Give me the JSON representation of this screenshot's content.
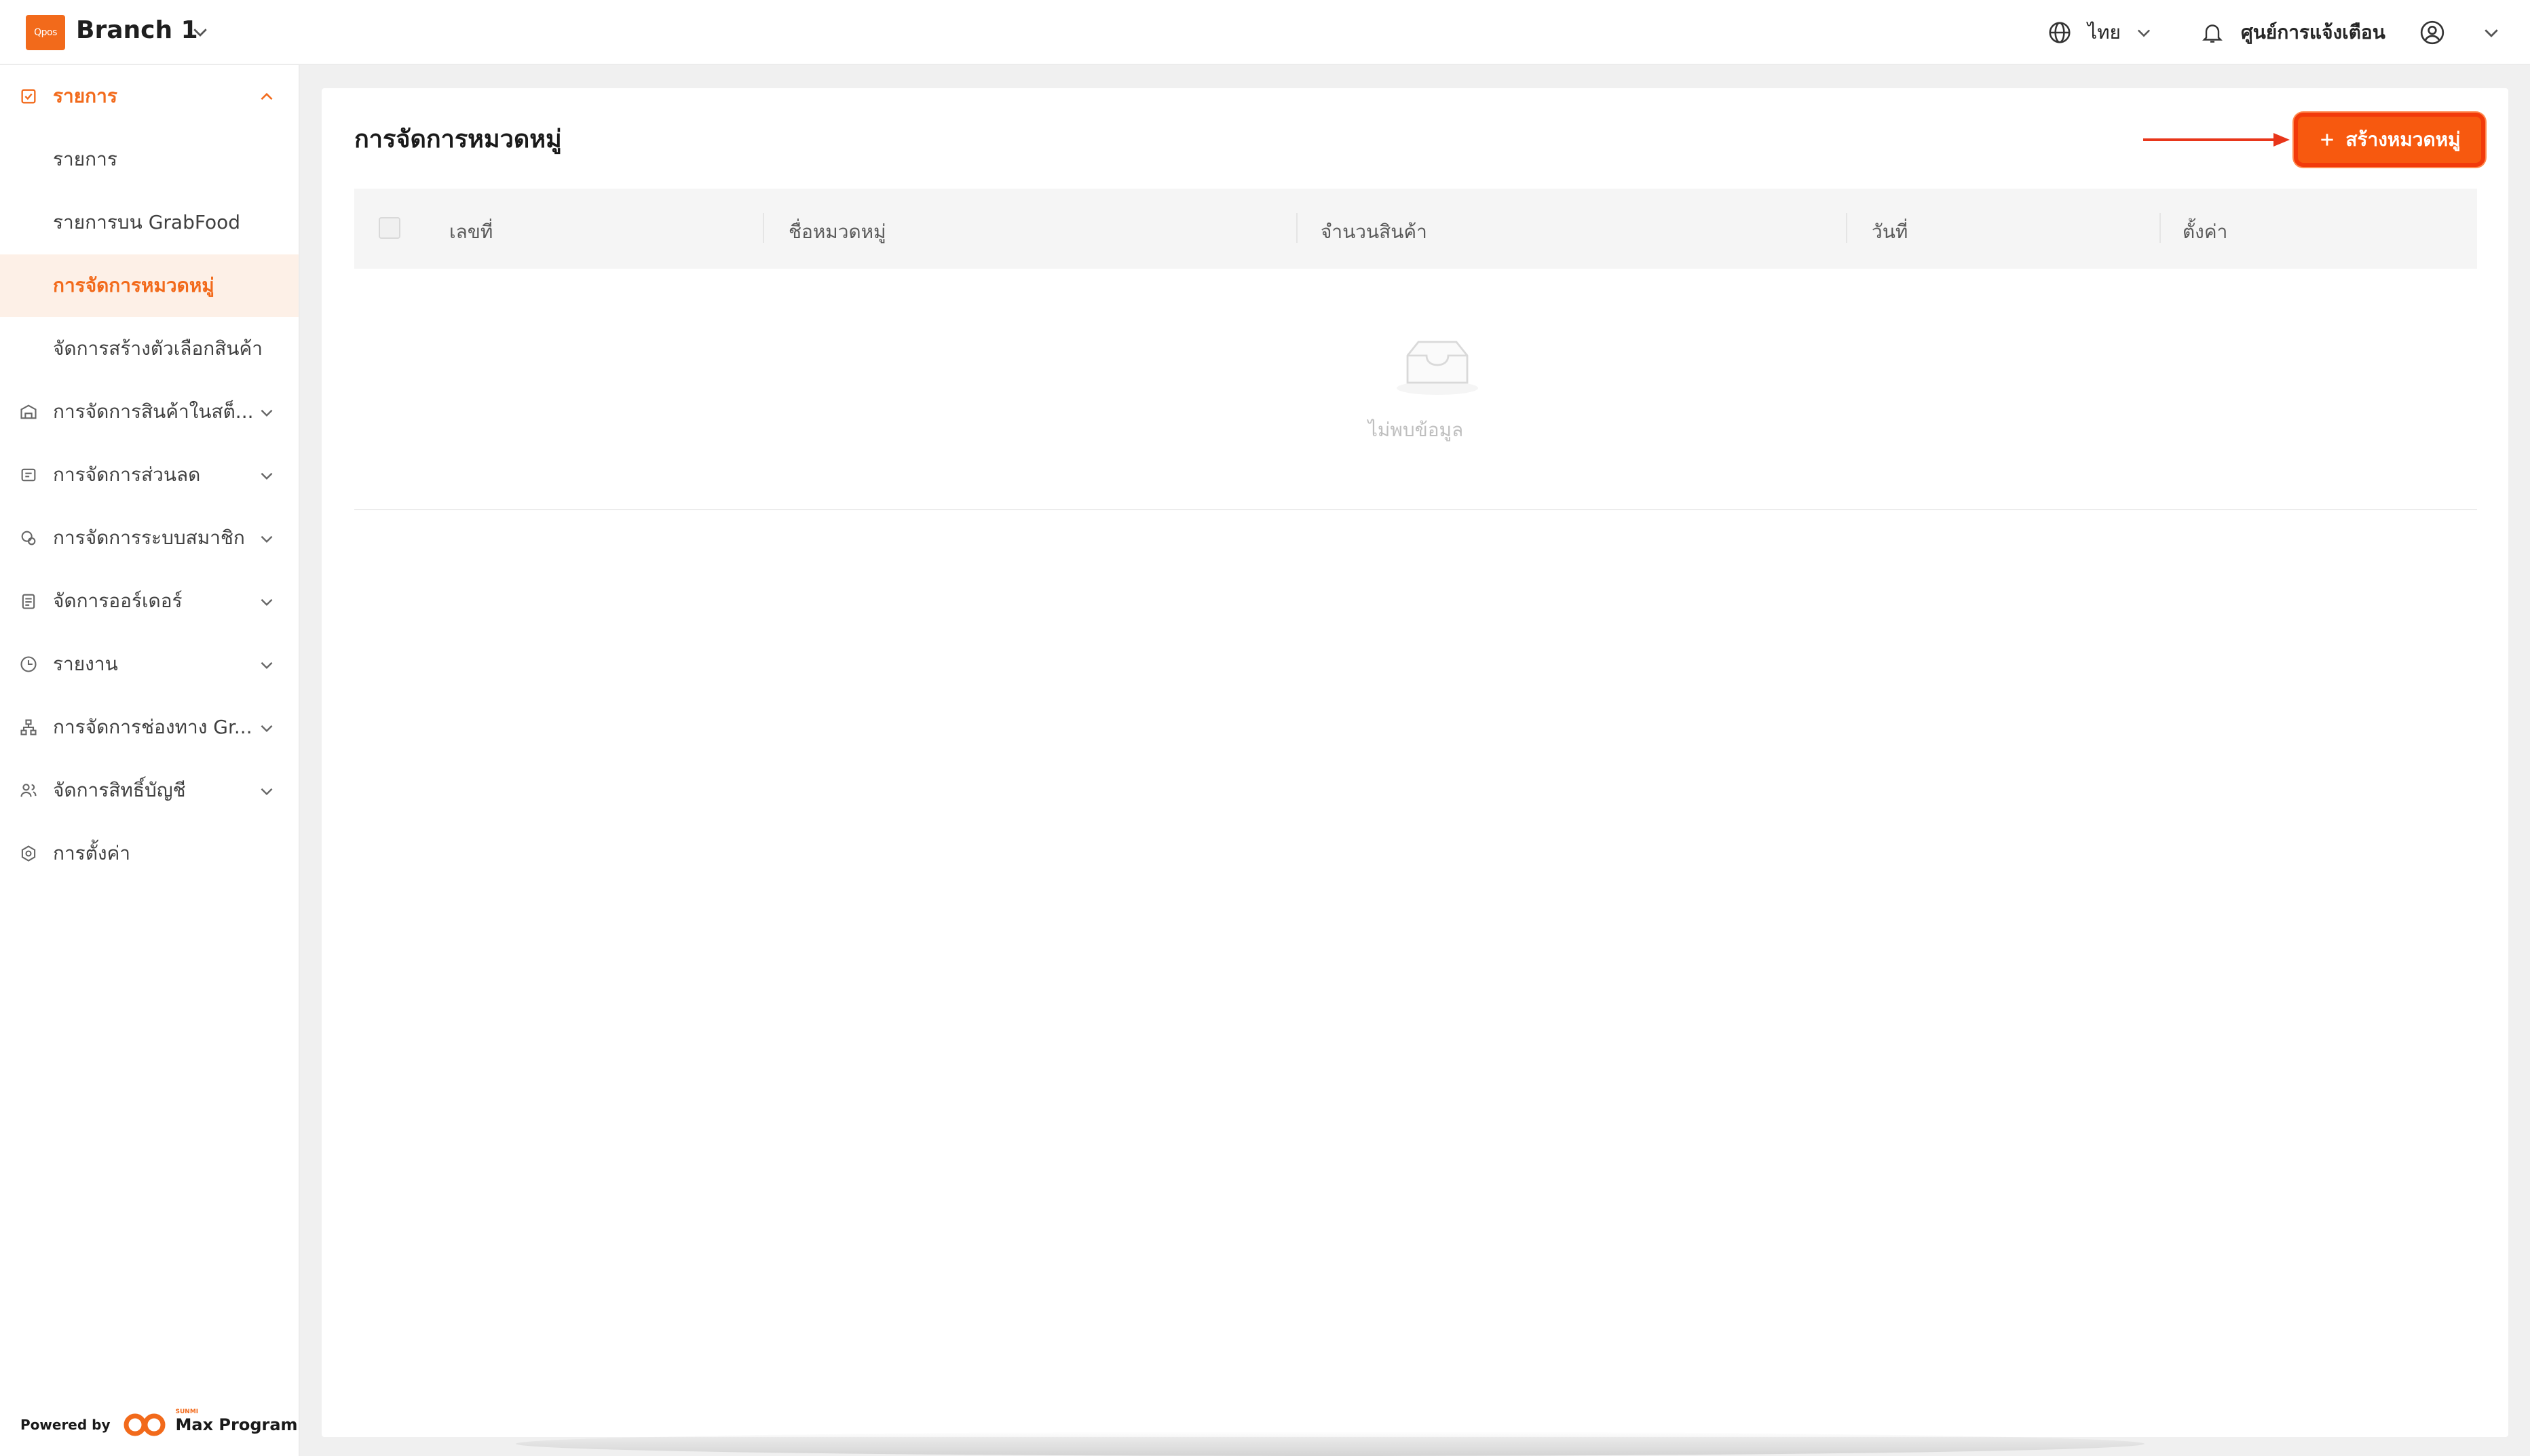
{
  "app": {
    "logo_text": "Qpos",
    "branch_name": "Branch 1",
    "brand_color": "#f26a1b"
  },
  "topbar": {
    "language": "ไทย",
    "notification_center": "ศูนย์การแจ้งเตือน"
  },
  "sidebar": {
    "items": [
      {
        "label": "รายการ",
        "icon": "calendar-check-icon",
        "expanded": true
      },
      {
        "label": "รายการ"
      },
      {
        "label": "รายการบน GrabFood"
      },
      {
        "label": "การจัดการหมวดหมู่",
        "selected": true
      },
      {
        "label": "จัดการสร้างตัวเลือกสินค้า"
      },
      {
        "label": "การจัดการสินค้าในสต็...",
        "icon": "warehouse-icon"
      },
      {
        "label": "การจัดการส่วนลด",
        "icon": "ticket-icon"
      },
      {
        "label": "การจัดการระบบสมาชิก",
        "icon": "member-icon"
      },
      {
        "label": "จัดการออร์เดอร์",
        "icon": "clipboard-icon"
      },
      {
        "label": "รายงาน",
        "icon": "clock-icon"
      },
      {
        "label": "การจัดการช่องทาง Gr...",
        "icon": "network-icon"
      },
      {
        "label": "จัดการสิทธิ์บัญชี",
        "icon": "users-icon"
      },
      {
        "label": "การตั้งค่า",
        "icon": "gear-icon"
      }
    ],
    "powered_by": "Powered by",
    "powered_brand": "Max Program",
    "powered_brand_sub": "SUNMI"
  },
  "main": {
    "title": "การจัดการหมวดหมู่",
    "create_button": "สร้างหมวดหมู่",
    "table": {
      "columns": [
        "เลขที่",
        "ชื่อหมวดหมู่",
        "จำนวนสินค้า",
        "วันที่",
        "ตั้งค่า"
      ],
      "rows": []
    },
    "empty_text": "ไม่พบข้อมูล"
  }
}
